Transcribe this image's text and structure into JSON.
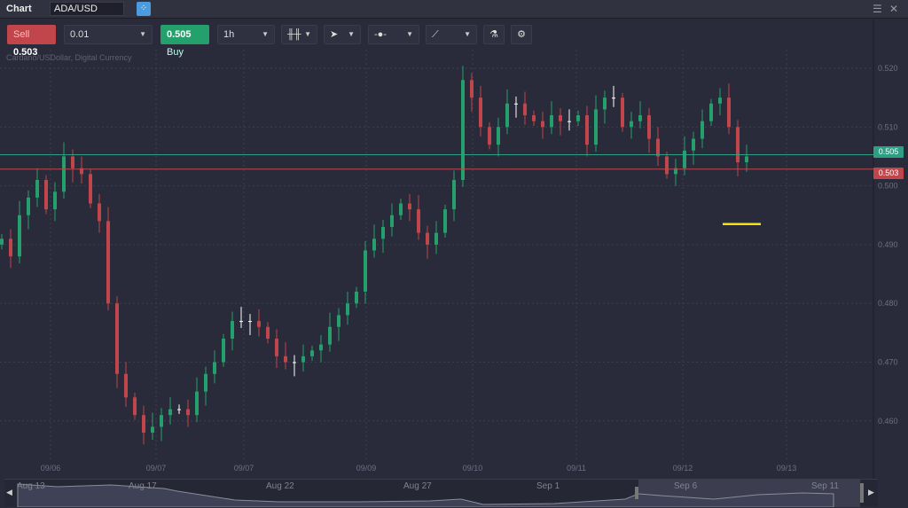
{
  "window": {
    "title": "Chart",
    "symbol": "ADA/USD",
    "menu_icon": "hamburger-icon",
    "close_icon": "close-icon"
  },
  "toolbar": {
    "sell_label": "Sell",
    "sell_price": "0.503",
    "quantity": "0.01",
    "buy_price": "0.505",
    "buy_label": "Buy",
    "timeframe": "1h"
  },
  "chart_title": "Cardano/USDollar, Digital Currency",
  "colors": {
    "up": "#23a06b",
    "down": "#c0464c",
    "ask_line": "#2e9e84",
    "bid_line": "#c0464c",
    "marker": "#f5e10a",
    "bg": "#2a2b3a"
  },
  "chart_data": {
    "type": "candlestick",
    "ylim": [
      0.455,
      0.523
    ],
    "y_ticks": [
      "0.520",
      "0.510",
      "0.500",
      "0.490",
      "0.480",
      "0.470",
      "0.460"
    ],
    "x_ticks": [
      "09/06",
      "09/07",
      "09/07",
      "09/09",
      "09/10",
      "09/11",
      "09/12",
      "09/13"
    ],
    "closes": [
      0.491,
      0.488,
      0.495,
      0.498,
      0.501,
      0.496,
      0.499,
      0.505,
      0.503,
      0.502,
      0.497,
      0.494,
      0.48,
      0.468,
      0.464,
      0.461,
      0.458,
      0.459,
      0.461,
      0.462,
      0.462,
      0.461,
      0.465,
      0.468,
      0.47,
      0.474,
      0.477,
      0.477,
      0.477,
      0.476,
      0.474,
      0.471,
      0.47,
      0.47,
      0.471,
      0.472,
      0.473,
      0.476,
      0.478,
      0.48,
      0.482,
      0.489,
      0.491,
      0.493,
      0.495,
      0.497,
      0.496,
      0.492,
      0.49,
      0.492,
      0.496,
      0.501,
      0.518,
      0.515,
      0.51,
      0.507,
      0.51,
      0.514,
      0.514,
      0.512,
      0.511,
      0.51,
      0.512,
      0.511,
      0.511,
      0.512,
      0.507,
      0.513,
      0.515,
      0.515,
      0.51,
      0.511,
      0.512,
      0.508,
      0.505,
      0.502,
      0.503,
      0.506,
      0.508,
      0.511,
      0.514,
      0.515,
      0.51,
      0.504,
      0.505
    ],
    "ask": {
      "value": 0.505,
      "label": "0.505"
    },
    "bid": {
      "value": 0.503,
      "label": "0.503"
    },
    "marker_level": 0.4935
  },
  "navigator": {
    "labels": [
      "Aug 13",
      "Aug 17",
      "Aug 22",
      "Aug 27",
      "Sep 1",
      "Sep 6",
      "Sep 11"
    ]
  }
}
